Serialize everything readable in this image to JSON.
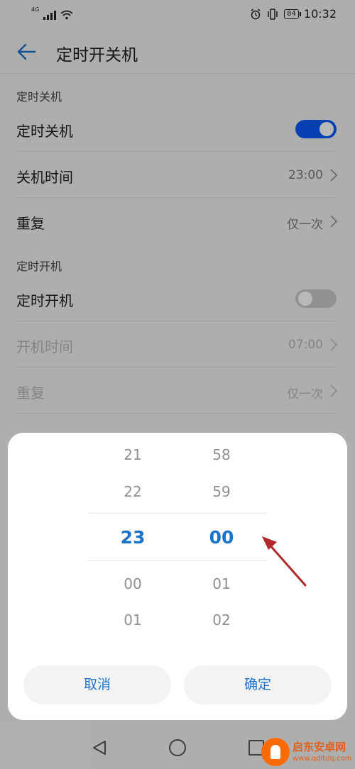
{
  "status": {
    "network": "4G",
    "battery": "84",
    "time": "10:32"
  },
  "header": {
    "title": "定时开关机"
  },
  "shutdown_section": {
    "label": "定时关机",
    "toggle_label": "定时关机",
    "toggle_on": true,
    "time_label": "关机时间",
    "time_value": "23:00",
    "repeat_label": "重复",
    "repeat_value": "仅一次"
  },
  "boot_section": {
    "label": "定时开机",
    "toggle_label": "定时开机",
    "toggle_on": false,
    "time_label": "开机时间",
    "time_value": "07:00",
    "repeat_label": "重复",
    "repeat_value": "仅一次"
  },
  "picker": {
    "hours": [
      "21",
      "22",
      "23",
      "00",
      "01"
    ],
    "minutes": [
      "58",
      "59",
      "00",
      "01",
      "02"
    ],
    "selected_hour": "23",
    "selected_minute": "00",
    "cancel_label": "取消",
    "confirm_label": "确定"
  },
  "colors": {
    "accent": "#1a73c8",
    "toggle_on": "#0a59f7",
    "arrow": "#b0282a"
  },
  "watermark": {
    "title": "启东安卓网",
    "url": "www.qdltdq.com"
  }
}
